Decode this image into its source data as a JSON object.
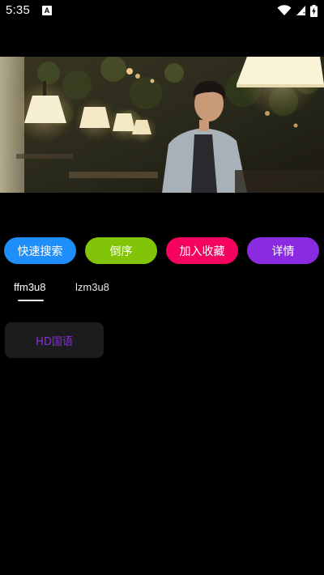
{
  "status_bar": {
    "time": "5:35",
    "app_icon_glyph": "A",
    "icons": [
      "wifi-icon",
      "cellular-signal-icon",
      "battery-charging-icon"
    ]
  },
  "video": {
    "description_icon": "video-player"
  },
  "actions": [
    {
      "label": "快速搜索",
      "color": "#1e8ffa"
    },
    {
      "label": "倒序",
      "color": "#82c408"
    },
    {
      "label": "加入收藏",
      "color": "#f5045f"
    },
    {
      "label": "详情",
      "color": "#8a2be2"
    }
  ],
  "tabs": [
    {
      "label": "ffm3u8",
      "selected": true
    },
    {
      "label": "lzm3u8",
      "selected": false
    }
  ],
  "episodes": [
    {
      "label": "HD国语",
      "color": "#8a2be2"
    }
  ],
  "colors": {
    "background": "#000000",
    "chip_background": "#1c1c1e",
    "tab_active": "#ffffff",
    "tab_inactive": "#e6e6e6"
  }
}
